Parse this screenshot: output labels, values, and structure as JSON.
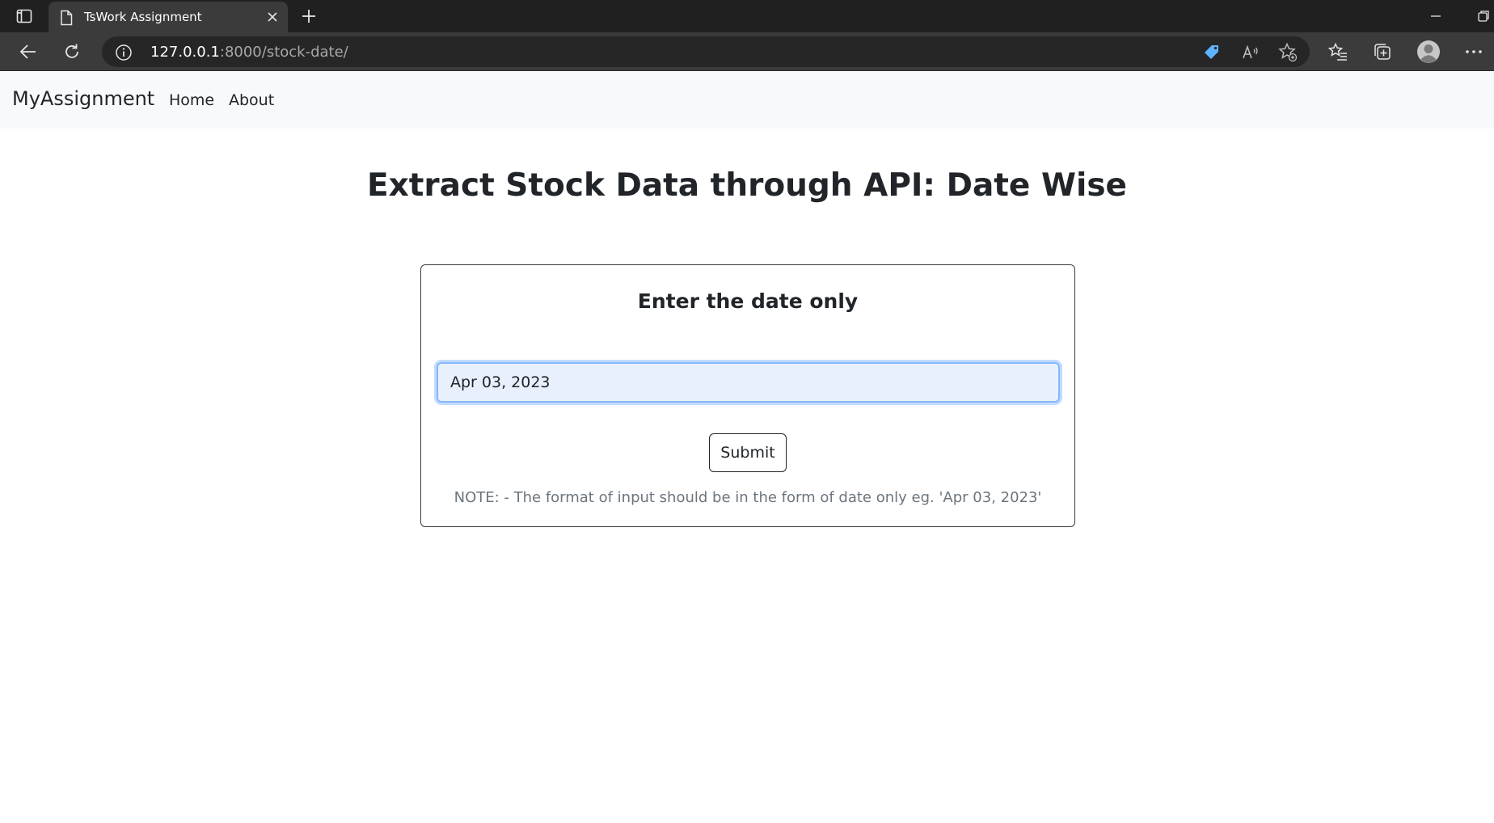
{
  "browser": {
    "tab": {
      "title": "TsWork Assignment"
    },
    "address": {
      "host": "127.0.0.1",
      "path": ":8000/stock-date/"
    },
    "icons": {
      "tab_actions": "tab-actions-icon",
      "favicon": "page-icon",
      "close": "close-icon",
      "new_tab": "plus-icon",
      "back": "back-arrow-icon",
      "refresh": "refresh-icon",
      "info": "info-icon",
      "coupon": "tag-icon",
      "read_aloud": "read-aloud-icon",
      "add_favorite": "star-add-icon",
      "favorites": "favorites-list-icon",
      "collections": "collections-icon",
      "profile": "profile-icon",
      "more": "ellipsis-icon"
    }
  },
  "navbar": {
    "brand": "MyAssignment",
    "links": [
      {
        "label": "Home"
      },
      {
        "label": "About"
      }
    ]
  },
  "main": {
    "title": "Extract Stock Data through API: Date Wise",
    "form": {
      "heading": "Enter the date only",
      "date_value": "Apr 03, 2023",
      "submit_label": "Submit",
      "note": "NOTE: - The format of input should be in the form of date only eg. 'Apr 03, 2023'"
    }
  },
  "colors": {
    "chrome_dark": "#202020",
    "chrome_toolbar": "#3b3b3b",
    "navbar_bg": "#f8f9fa",
    "text_primary": "#212529",
    "text_muted": "#6c757d",
    "input_bg": "#e8f0fe",
    "input_focus_border": "#86b7fe",
    "coupon_icon": "#5eb3ff"
  }
}
